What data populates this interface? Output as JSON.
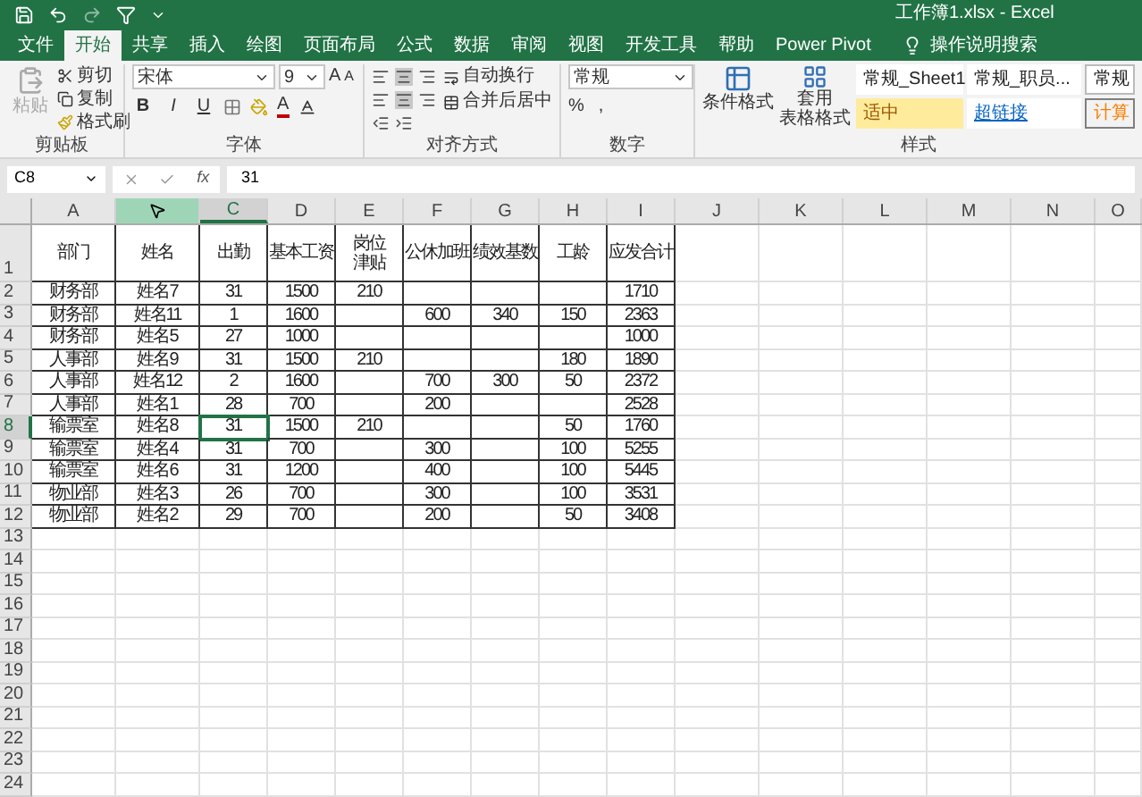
{
  "title_bar": {
    "title": "工作簿1.xlsx  -  Excel"
  },
  "ribbon_tabs": [
    {
      "label": "文件",
      "selected": false
    },
    {
      "label": "开始",
      "selected": true
    },
    {
      "label": "共享",
      "selected": false
    },
    {
      "label": "插入",
      "selected": false
    },
    {
      "label": "绘图",
      "selected": false
    },
    {
      "label": "页面布局",
      "selected": false
    },
    {
      "label": "公式",
      "selected": false
    },
    {
      "label": "数据",
      "selected": false
    },
    {
      "label": "审阅",
      "selected": false
    },
    {
      "label": "视图",
      "selected": false
    },
    {
      "label": "开发工具",
      "selected": false
    },
    {
      "label": "帮助",
      "selected": false
    },
    {
      "label": "Power Pivot",
      "selected": false
    }
  ],
  "tell_me": {
    "label": "操作说明搜索"
  },
  "clipboard": {
    "paste": {
      "label": "粘贴",
      "disabled": true
    },
    "cut": "剪切",
    "copy": "复制",
    "format_painter": "格式刷",
    "label": "剪贴板"
  },
  "font": {
    "name": "宋体",
    "size": "9",
    "bold": "B",
    "italic": "I",
    "underline": "U",
    "grow": "A",
    "shrink": "A",
    "color_letter": "A",
    "label": "字体"
  },
  "alignment": {
    "wrap": "自动换行",
    "merge": "合并后居中",
    "label": "对齐方式"
  },
  "number": {
    "format": "常规",
    "percent": "%",
    "comma": ",",
    "label": "数字"
  },
  "styles": {
    "conditional": "条件格式",
    "table_format": [
      "套用",
      "表格格式"
    ],
    "label": "样式",
    "cells": [
      {
        "label": "常规_Sheet1",
        "kind": "small"
      },
      {
        "label": "常规_职员...",
        "kind": "large"
      },
      {
        "label": "常规",
        "kind": "boxed"
      },
      {
        "label": "适中",
        "kind": "neutral"
      },
      {
        "label": "超链接",
        "kind": "link"
      },
      {
        "label": "计算",
        "kind": "calc"
      }
    ]
  },
  "formula_bar": {
    "name_box": "C8",
    "fx": "fx",
    "value": "31"
  },
  "sheet": {
    "columns": [
      {
        "label": "A",
        "selected": false,
        "hovered": false
      },
      {
        "selected": false,
        "hovered": true
      },
      {
        "label": "C",
        "selected": true,
        "hovered": false
      },
      {
        "label": "D",
        "selected": false,
        "hovered": false
      },
      {
        "label": "E",
        "selected": false,
        "hovered": false,
        "wrap_text": true
      },
      {
        "label": "F",
        "selected": false,
        "hovered": false
      },
      {
        "label": "G",
        "selected": false,
        "hovered": false
      },
      {
        "label": "H",
        "selected": false,
        "hovered": false
      },
      {
        "label": "I",
        "selected": false,
        "hovered": false
      },
      {
        "label": "J",
        "selected": false,
        "hovered": false
      },
      {
        "label": "K",
        "selected": false,
        "hovered": false
      },
      {
        "label": "L",
        "selected": false,
        "hovered": false
      },
      {
        "label": "M",
        "selected": false,
        "hovered": false
      },
      {
        "label": "N",
        "selected": false,
        "hovered": false
      },
      {
        "label": "O",
        "selected": false,
        "hovered": false
      }
    ],
    "rows": [
      {
        "number": "1",
        "selected": false,
        "cells": [
          "部门",
          "姓名",
          "出勤",
          "基本工资",
          "岗位津贴",
          "公休加班",
          "绩效基数",
          "工龄",
          "应发合计"
        ]
      },
      {
        "number": "2",
        "selected": false,
        "cells": [
          "财务部",
          "姓名7",
          "31",
          "1500",
          "210",
          null,
          null,
          null,
          "1710"
        ]
      },
      {
        "number": "3",
        "selected": false,
        "cells": [
          "财务部",
          "姓名11",
          "1",
          "1600",
          null,
          "600",
          "340",
          "150",
          "2363"
        ]
      },
      {
        "number": "4",
        "selected": false,
        "cells": [
          "财务部",
          "姓名5",
          "27",
          "1000",
          null,
          null,
          null,
          null,
          "1000"
        ]
      },
      {
        "number": "5",
        "selected": false,
        "cells": [
          "人事部",
          "姓名9",
          "31",
          "1500",
          "210",
          null,
          null,
          "180",
          "1890"
        ]
      },
      {
        "number": "6",
        "selected": false,
        "cells": [
          "人事部",
          "姓名12",
          "2",
          "1600",
          null,
          "700",
          "300",
          "50",
          "2372"
        ]
      },
      {
        "number": "7",
        "selected": false,
        "cells": [
          "人事部",
          "姓名1",
          "28",
          "700",
          null,
          "200",
          null,
          null,
          "2528"
        ]
      },
      {
        "number": "8",
        "selected": true,
        "cells": [
          "输票室",
          "姓名8",
          "31",
          "1500",
          "210",
          null,
          null,
          "50",
          "1760"
        ]
      },
      {
        "number": "9",
        "selected": false,
        "cells": [
          "输票室",
          "姓名4",
          "31",
          "700",
          null,
          "300",
          null,
          "100",
          "5255"
        ]
      },
      {
        "number": "10",
        "selected": false,
        "cells": [
          "输票室",
          "姓名6",
          "31",
          "1200",
          null,
          "400",
          null,
          "100",
          "5445"
        ]
      },
      {
        "number": "11",
        "selected": false,
        "cells": [
          "物业部",
          "姓名3",
          "26",
          "700",
          null,
          "300",
          null,
          "100",
          "3531"
        ]
      },
      {
        "number": "12",
        "selected": false,
        "cells": [
          "物业部",
          "姓名2",
          "29",
          "700",
          null,
          "200",
          null,
          "50",
          "3408"
        ]
      },
      {
        "number": "13",
        "selected": false
      },
      {
        "number": "14",
        "selected": false
      },
      {
        "number": "15",
        "selected": false
      },
      {
        "number": "16",
        "selected": false
      },
      {
        "number": "17",
        "selected": false
      },
      {
        "number": "18",
        "selected": false
      },
      {
        "number": "19",
        "selected": false
      },
      {
        "number": "20",
        "selected": false
      },
      {
        "number": "21",
        "selected": false
      },
      {
        "number": "22",
        "selected": false
      },
      {
        "number": "23",
        "selected": false
      },
      {
        "number": "24",
        "selected": false
      }
    ]
  }
}
